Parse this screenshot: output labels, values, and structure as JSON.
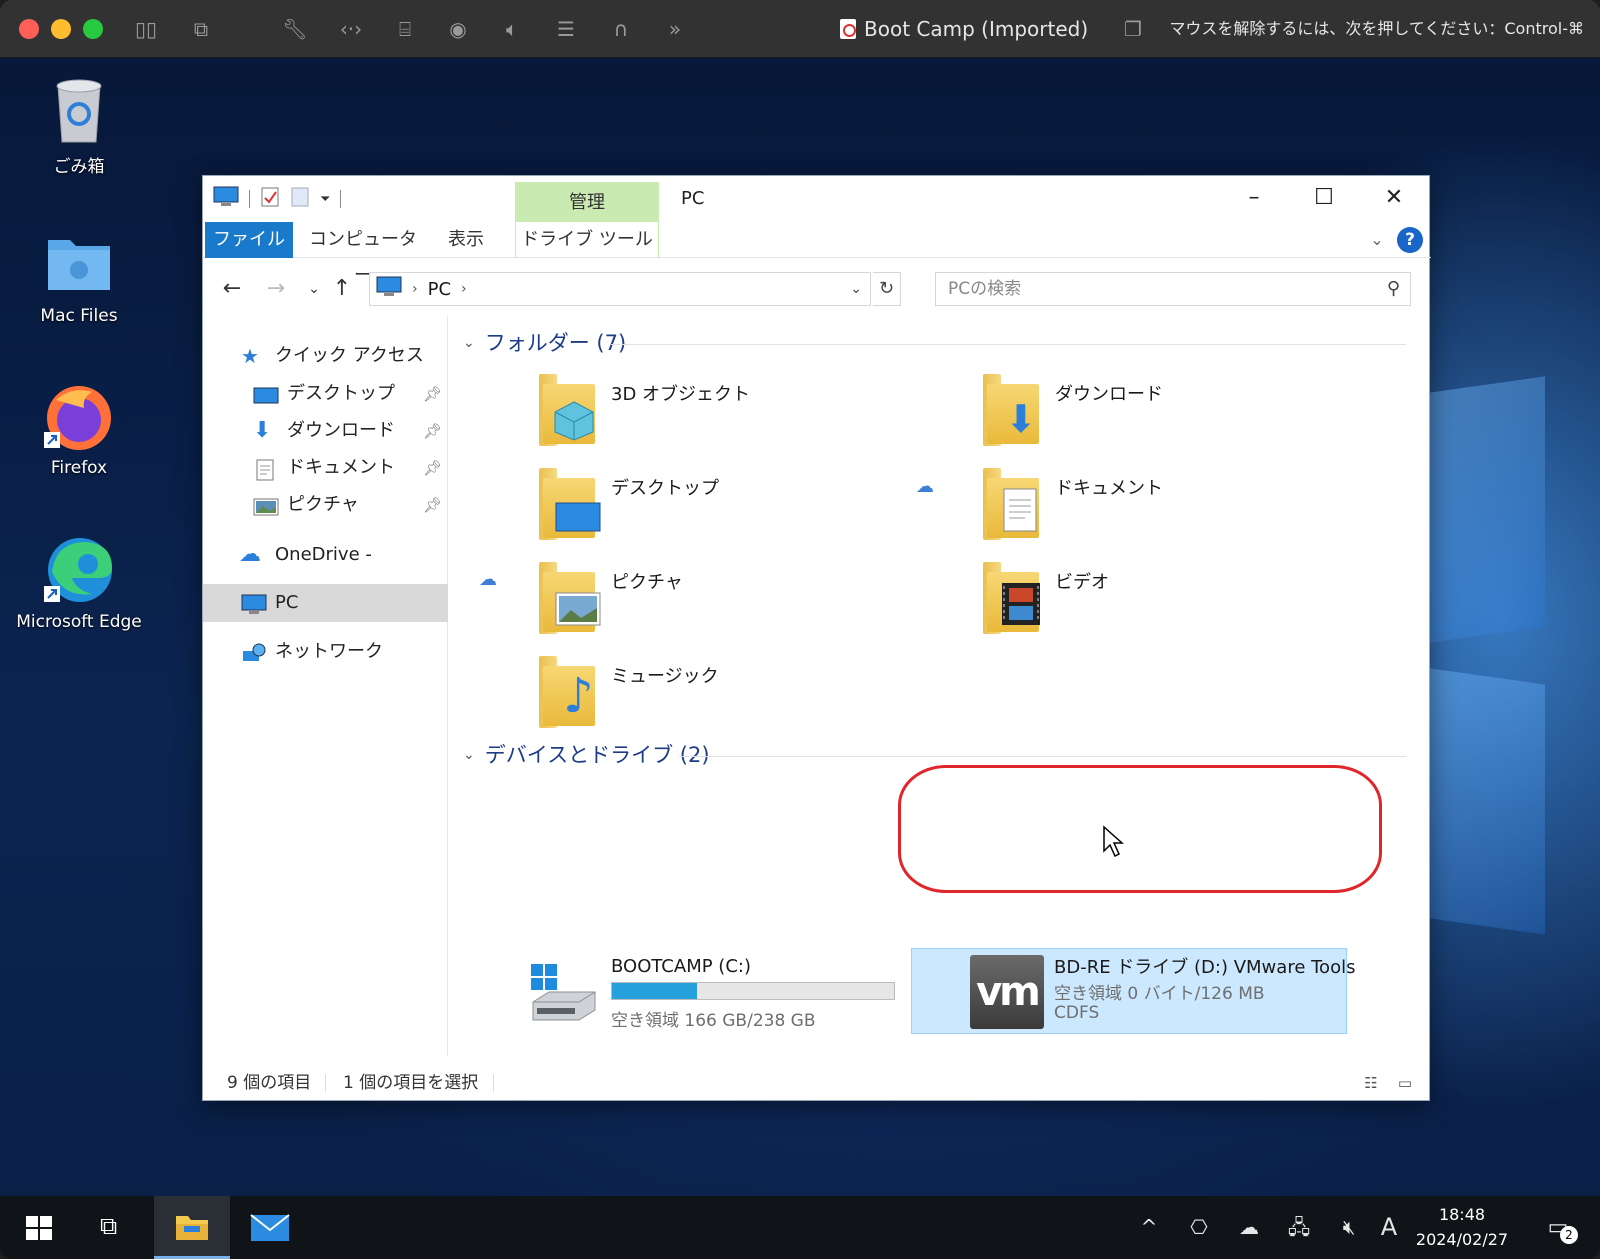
{
  "host": {
    "vm_title": "Boot Camp (Imported)",
    "release_hint": "マウスを解除するには、次を押してください：Control-⌘"
  },
  "desktop": {
    "icons": [
      {
        "label": "ごみ箱"
      },
      {
        "label": "Mac Files"
      },
      {
        "label": "Firefox"
      },
      {
        "label": "Microsoft Edge"
      }
    ]
  },
  "explorer": {
    "manage_tab": "管理",
    "title": "PC",
    "ribbon_tabs": {
      "file": "ファイル",
      "computer": "コンピューター",
      "view": "表示",
      "drive_tools": "ドライブ ツール"
    },
    "address": {
      "location": "PC"
    },
    "search_placeholder": "PCの検索",
    "nav": {
      "quick_access": "クイック アクセス",
      "desktop": "デスクトップ",
      "downloads": "ダウンロード",
      "documents": "ドキュメント",
      "pictures": "ピクチャ",
      "onedrive": "OneDrive - Personal",
      "pc": "PC",
      "network": "ネットワーク"
    },
    "folders_header": "フォルダー (7)",
    "folders": {
      "objects3d": "3D オブジェクト",
      "downloads": "ダウンロード",
      "desktop": "デスクトップ",
      "documents": "ドキュメント",
      "pictures": "ピクチャ",
      "videos": "ビデオ",
      "music": "ミュージック"
    },
    "drives_header": "デバイスとドライブ (2)",
    "drives": {
      "c": {
        "name": "BOOTCAMP (C:)",
        "space": "空き領域 166 GB/238 GB",
        "used_fraction": 0.3
      },
      "d": {
        "name": "BD-RE ドライブ (D:) VMware Tools",
        "space": "空き領域 0 バイト/126 MB",
        "fs": "CDFS",
        "logo": "vm"
      }
    },
    "status": {
      "items": "9 個の項目",
      "selected": "1 個の項目を選択"
    }
  },
  "taskbar": {
    "time": "18:48",
    "date": "2024/02/27",
    "ime": "A",
    "notifications": "2"
  }
}
